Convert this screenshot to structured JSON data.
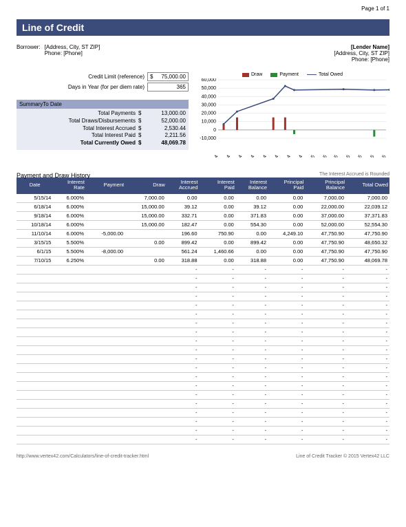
{
  "page_num": "Page 1 of 1",
  "title": "Line of Credit",
  "borrower": {
    "label": "Borrower:",
    "address": "[Address, City, ST ZIP]",
    "phone": "Phone: [Phone]"
  },
  "lender": {
    "name": "[Lender Name]",
    "address": "[Address, City, ST  ZIP]",
    "phone": "Phone: [Phone]"
  },
  "inputs": {
    "credit_limit_label": "Credit Limit (reference)",
    "credit_limit_dollar": "$",
    "credit_limit_value": "75,000.00",
    "days_label": "Days in Year (for per diem rate)",
    "days_value": "365"
  },
  "summary": {
    "header": "SummaryTo Date",
    "rows": [
      {
        "label": "Total Payments",
        "dollar": "$",
        "value": "13,000.00"
      },
      {
        "label": "Total Draws/Disbursements",
        "dollar": "$",
        "value": "52,000.00"
      },
      {
        "label": "Total Interest Accrued",
        "dollar": "$",
        "value": "2,530.44"
      },
      {
        "label": "Total Interest Paid",
        "dollar": "$",
        "value": "2,211.56"
      }
    ],
    "total": {
      "label": "Total Currently Owed",
      "dollar": "$",
      "value": "48,069.78"
    }
  },
  "chart_data": {
    "type": "combo",
    "legend": [
      "Draw",
      "Payment",
      "Total Owed"
    ],
    "xlabels": [
      "5/1/14",
      "6/1/14",
      "7/1/14",
      "8/1/14",
      "9/1/14",
      "10/1/14",
      "11/1/14",
      "12/1/14",
      "1/1/15",
      "2/1/15",
      "3/1/15",
      "4/1/15",
      "5/1/15",
      "6/1/15",
      "7/1/15"
    ],
    "yticks": [
      -10000,
      0,
      10000,
      20000,
      30000,
      40000,
      50000,
      60000
    ],
    "series_owed": {
      "name": "Total Owed",
      "x": [
        "5/15/14",
        "6/18/14",
        "9/18/14",
        "10/18/14",
        "11/10/14",
        "3/15/15",
        "6/1/15",
        "7/10/15"
      ],
      "y": [
        7000,
        22039,
        37372,
        52554,
        47751,
        48650,
        47751,
        48070
      ]
    },
    "bars_draw": {
      "name": "Draw",
      "points": [
        {
          "x": "5/15/14",
          "y": 7000
        },
        {
          "x": "6/18/14",
          "y": 15000
        },
        {
          "x": "9/18/14",
          "y": 15000
        },
        {
          "x": "10/18/14",
          "y": 15000
        }
      ]
    },
    "bars_payment": {
      "name": "Payment",
      "points": [
        {
          "x": "11/10/14",
          "y": -5000
        },
        {
          "x": "6/1/15",
          "y": -8000
        }
      ]
    },
    "ylim": [
      -10000,
      60000
    ]
  },
  "history": {
    "title": "Payment and Draw History",
    "note": "The Interest Accrued is Rounded",
    "columns": [
      "Date",
      "Interest\nRate",
      "Payment",
      "Draw",
      "Interest\nAccrued",
      "Interest\nPaid",
      "Interest\nBalance",
      "Principal\nPaid",
      "Principal\nBalance",
      "Total Owed"
    ],
    "rows": [
      [
        "5/15/14",
        "6.000%",
        "",
        "7,000.00",
        "0.00",
        "0.00",
        "0.00",
        "0.00",
        "7,000.00",
        "7,000.00"
      ],
      [
        "6/18/14",
        "6.000%",
        "",
        "15,000.00",
        "39.12",
        "0.00",
        "39.12",
        "0.00",
        "22,000.00",
        "22,039.12"
      ],
      [
        "9/18/14",
        "6.000%",
        "",
        "15,000.00",
        "332.71",
        "0.00",
        "371.83",
        "0.00",
        "37,000.00",
        "37,371.83"
      ],
      [
        "10/18/14",
        "6.000%",
        "",
        "15,000.00",
        "182.47",
        "0.00",
        "554.30",
        "0.00",
        "52,000.00",
        "52,554.30"
      ],
      [
        "11/10/14",
        "6.000%",
        "-5,000.00",
        "",
        "196.60",
        "750.90",
        "0.00",
        "4,249.10",
        "47,750.90",
        "47,750.90"
      ],
      [
        "3/15/15",
        "5.500%",
        "",
        "0.00",
        "899.42",
        "0.00",
        "899.42",
        "0.00",
        "47,750.90",
        "48,650.32"
      ],
      [
        "6/1/15",
        "5.500%",
        "-8,000.00",
        "",
        "561.24",
        "1,460.66",
        "0.00",
        "0.00",
        "47,750.90",
        "47,750.90"
      ],
      [
        "7/10/15",
        "6.250%",
        "",
        "0.00",
        "318.88",
        "0.00",
        "318.88",
        "0.00",
        "47,750.90",
        "48,069.78"
      ]
    ],
    "empty_rows": 20
  },
  "footer": {
    "left": "http://www.vertex42.com/Calculators/line-of-credit-tracker.html",
    "right": "Line of Credit Tracker © 2015 Vertex42 LLC"
  }
}
